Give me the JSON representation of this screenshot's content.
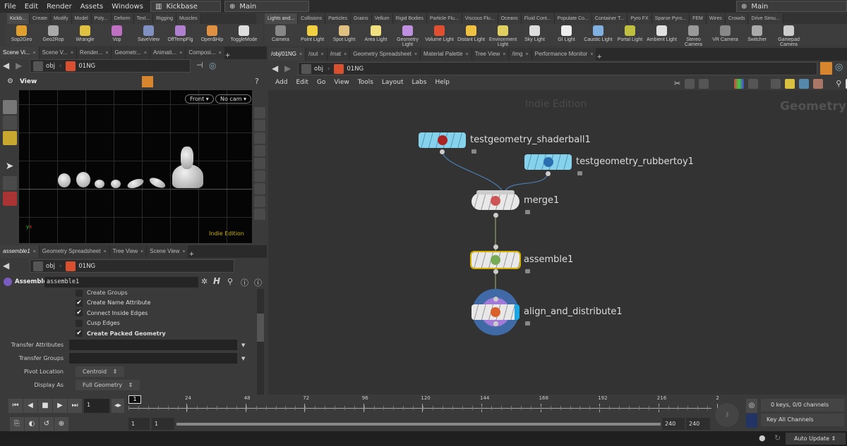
{
  "menu": [
    "File",
    "Edit",
    "Render",
    "Assets",
    "Windows",
    "Help"
  ],
  "desktop": "Kickbase",
  "context": "Main",
  "context_right": "Main",
  "shelf_left": {
    "tabs": [
      "Kickb...",
      "Create",
      "Modify",
      "Model",
      "Poly...",
      "Deform",
      "Text...",
      "Rigging",
      "Muscles"
    ],
    "tools": [
      {
        "label": "Sop2Geo",
        "color": "#e0a030"
      },
      {
        "label": "Geo2Rop",
        "color": "#aaaaaa"
      },
      {
        "label": "Wrangle",
        "color": "#e0c040"
      },
      {
        "label": "Vop",
        "color": "#c070c0"
      },
      {
        "label": "SaveView",
        "color": "#8090c0"
      },
      {
        "label": "OffTempFlg",
        "color": "#b080d0"
      },
      {
        "label": "Open$Hip",
        "color": "#e09040"
      },
      {
        "label": "ToggleMode",
        "color": "#dddddd"
      }
    ]
  },
  "shelf_right": {
    "tabs": [
      "Lights and...",
      "Collisions",
      "Particles",
      "Grains",
      "Vellum",
      "Rigid Bodies",
      "Particle Flu...",
      "Viscous Flu...",
      "Oceans",
      "Fluid Cont...",
      "Populate Co...",
      "Container T...",
      "Pyro FX",
      "Sparse Pyro...",
      "FEM",
      "Wires",
      "Crowds",
      "Drive Simu..."
    ],
    "tools": [
      {
        "label": "Camera",
        "color": "#888"
      },
      {
        "label": "Point Light",
        "color": "#f0d040"
      },
      {
        "label": "Spot Light",
        "color": "#e0c080"
      },
      {
        "label": "Area Light",
        "color": "#f0e080"
      },
      {
        "label": "Geometry Light",
        "color": "#c090e0"
      },
      {
        "label": "Volume Light",
        "color": "#e05030"
      },
      {
        "label": "Distant Light",
        "color": "#f0c040"
      },
      {
        "label": "Environment Light",
        "color": "#e0d060"
      },
      {
        "label": "Sky Light",
        "color": "#dddddd"
      },
      {
        "label": "GI Light",
        "color": "#eeeeee"
      },
      {
        "label": "Caustic Light",
        "color": "#80b0e0"
      },
      {
        "label": "Portal Light",
        "color": "#c0c040"
      },
      {
        "label": "Ambient Light",
        "color": "#e0e0e0"
      },
      {
        "label": "Stereo Camera",
        "color": "#999"
      },
      {
        "label": "VR Camera",
        "color": "#888"
      },
      {
        "label": "Switcher",
        "color": "#aaa"
      },
      {
        "label": "Gamepad Camera",
        "color": "#ccc"
      }
    ]
  },
  "left_tabs": [
    "Scene Vi...",
    "Scene V...",
    "Render...",
    "Geometr...",
    "Animati...",
    "Composi..."
  ],
  "right_tabs": [
    "/obj/01NG",
    "/out",
    "/mat",
    "Geometry Spreadsheet",
    "Material Palette",
    "Tree View",
    "/img",
    "Performance Monitor"
  ],
  "path": {
    "root": "obj",
    "node": "01NG"
  },
  "viewport": {
    "title": "View",
    "view": "Front",
    "cam": "No cam",
    "watermark": "Indie Edition"
  },
  "param_tabs": [
    "assemble1",
    "Geometry Spreadsheet",
    "Tree View",
    "Scene View"
  ],
  "params": {
    "node_type": "Assemble",
    "node_name": "assemble1",
    "cut_off": "Create Groups",
    "checks": [
      {
        "label": "Create Name Attribute",
        "checked": true
      },
      {
        "label": "Connect Inside Edges",
        "checked": true
      },
      {
        "label": "Cusp Edges",
        "checked": false
      },
      {
        "label": "Create Packed Geometry",
        "checked": true
      }
    ],
    "transfer_attributes": {
      "label": "Transfer Attributes",
      "value": ""
    },
    "transfer_groups": {
      "label": "Transfer Groups",
      "value": ""
    },
    "pivot": {
      "label": "Pivot Location",
      "value": "Centroid"
    },
    "display": {
      "label": "Display As",
      "value": "Full Geometry"
    }
  },
  "network": {
    "menu": [
      "Add",
      "Edit",
      "Go",
      "View",
      "Tools",
      "Layout",
      "Labs",
      "Help"
    ],
    "watermark": "Indie Edition",
    "context_label": "Geometry",
    "nodes": [
      {
        "name": "testgeometry_shaderball1",
        "type": "input"
      },
      {
        "name": "testgeometry_rubbertoy1",
        "type": "input"
      },
      {
        "name": "merge1",
        "type": "merge"
      },
      {
        "name": "assemble1",
        "type": "selected"
      },
      {
        "name": "align_and_distribute1",
        "type": "display"
      }
    ]
  },
  "timeline": {
    "current_frame": "1",
    "ticks": [
      "24",
      "48",
      "72",
      "96",
      "120",
      "144",
      "168",
      "192",
      "216",
      "2"
    ],
    "marker": "1",
    "start": "1",
    "range_start": "1",
    "range_end": "240",
    "end": "240",
    "keys": "0 keys, 0/0 channels",
    "key_mode": "Key All Channels",
    "update": "Auto Update"
  },
  "colors": {
    "accent": "#d8862e",
    "input_node": "#86d2ec",
    "selected_outline": "#d4b000",
    "display_flag": "#1aa7e8"
  }
}
